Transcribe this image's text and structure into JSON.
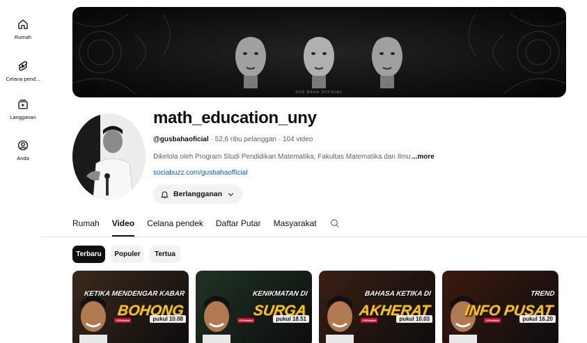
{
  "sidebar": {
    "items": [
      {
        "label": "Rumah",
        "icon": "home-icon"
      },
      {
        "label": "Celana pend...",
        "icon": "shorts-icon"
      },
      {
        "label": "Langganan",
        "icon": "subscriptions-icon"
      },
      {
        "label": "Anda",
        "icon": "you-icon"
      }
    ]
  },
  "banner": {
    "text": "GUS BAHA OFFICIAL"
  },
  "channel": {
    "title": "math_education_uny",
    "handle": "@gusbahaoficial",
    "stats": " · 52,6 ribu pelanggan · 104 video",
    "description": "Dikelola oleh Program Studi Pendidikan Matematika, Fakultas Matematika dan Ilmu",
    "more_label": "...more",
    "link": "sociabuzz.com/gusbahaofficial",
    "subscribe_label": "Berlangganan"
  },
  "tabs": [
    {
      "label": "Rumah",
      "active": false
    },
    {
      "label": "Video",
      "active": true
    },
    {
      "label": "Celana pendek",
      "active": false
    },
    {
      "label": "Daftar Putar",
      "active": false
    },
    {
      "label": "Masyarakat",
      "active": false
    }
  ],
  "chips": [
    {
      "label": "Terbaru",
      "active": true
    },
    {
      "label": "Populer",
      "active": false
    },
    {
      "label": "Tertua",
      "active": false
    }
  ],
  "videos": [
    {
      "line1": "KETIKA MENDENGAR KABAR",
      "line2": "BOHONG",
      "time": "pukul 10.08",
      "tag": "CERAMAH",
      "bg": "#3a2a1c"
    },
    {
      "line1": "KENIKMATAN DI",
      "line2": "SURGA",
      "time": "pukul 18.51",
      "tag": "CERAMAH",
      "bg": "#1f3323"
    },
    {
      "line1": "BAHASA KETIKA DI",
      "line2": "AKHERAT",
      "time": "pukul 10.03",
      "tag": "CERAMAH",
      "bg": "#3a1f14"
    },
    {
      "line1": "TREND",
      "line2": "INFO PUSAT",
      "time": "pukul 16.20",
      "tag": "CERAMAH",
      "bg": "#3b1a10"
    }
  ],
  "colors": {
    "link": "#065fd4",
    "text": "#0f0f0f",
    "secondary_text": "#606060",
    "chip_bg": "#f2f2f2",
    "thumb_title": "#f5c518"
  }
}
